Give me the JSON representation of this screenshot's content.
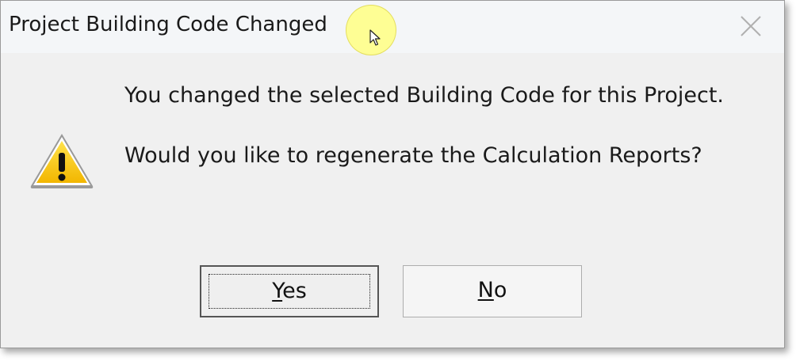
{
  "dialog": {
    "title": "Project Building Code Changed",
    "message_line_1": "You changed the selected Building Code for this Project.",
    "message_line_2": "Would you like to regenerate the Calculation Reports?",
    "icon": "warning-icon",
    "buttons": {
      "yes": {
        "mnemonic": "Y",
        "rest": "es"
      },
      "no": {
        "mnemonic": "N",
        "rest": "o"
      }
    }
  },
  "colors": {
    "dialog_bg": "#f0f0f0",
    "titlebar_bg": "#f4f6f8",
    "warning_yellow": "#f5c400",
    "cursor_highlight": "#ffff82"
  }
}
